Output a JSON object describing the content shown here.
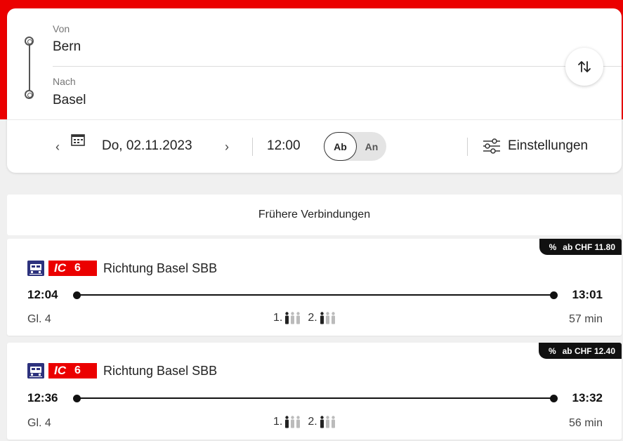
{
  "search": {
    "from_label": "Von",
    "from_value": "Bern",
    "to_label": "Nach",
    "to_value": "Basel",
    "date": "Do, 02.11.2023",
    "time": "12:00",
    "mode_departure": "Ab",
    "mode_arrival": "An",
    "mode_selected": "Ab",
    "settings_label": "Einstellungen"
  },
  "earlier_label": "Frühere Verbindungen",
  "connections": [
    {
      "price_pct": "%",
      "price_label": "ab CHF  11.80",
      "train_type": "IC",
      "train_number": "6",
      "direction": "Richtung Basel SBB",
      "departure": "12:04",
      "arrival": "13:01",
      "platform": "Gl. 4",
      "first_class_label": "1.",
      "second_class_label": "2.",
      "duration": "57 min"
    },
    {
      "price_pct": "%",
      "price_label": "ab CHF  12.40",
      "train_type": "IC",
      "train_number": "6",
      "direction": "Richtung Basel SBB",
      "departure": "12:36",
      "arrival": "13:32",
      "platform": "Gl. 4",
      "first_class_label": "1.",
      "second_class_label": "2.",
      "duration": "56 min"
    }
  ],
  "icons": {
    "prev": "chevron-left-icon",
    "next": "chevron-right-icon",
    "calendar": "calendar-icon",
    "swap": "swap-icon",
    "settings": "sliders-icon",
    "train": "train-icon",
    "occupancy": "person-icon"
  },
  "colors": {
    "brand_red": "#eb0000",
    "train_blue": "#2d327d",
    "badge_black": "#111111"
  }
}
